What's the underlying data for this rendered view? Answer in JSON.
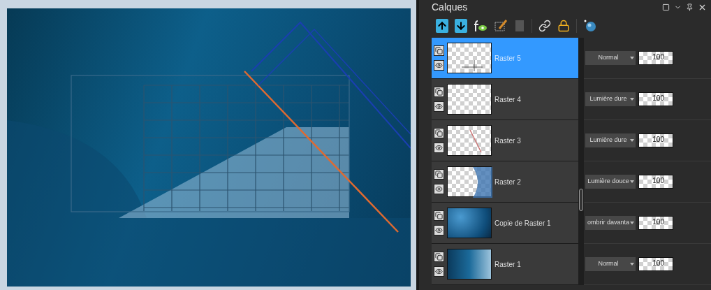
{
  "panel": {
    "title": "Calques"
  },
  "layers": [
    {
      "name": "Raster 5",
      "selected": true,
      "kind": "cross",
      "blend_mode": "Normal",
      "opacity": "100"
    },
    {
      "name": "Raster 4",
      "selected": false,
      "kind": "empty",
      "blend_mode": "Lumière dure",
      "opacity": "100"
    },
    {
      "name": "Raster 3",
      "selected": false,
      "kind": "line",
      "blend_mode": "Lumière dure",
      "opacity": "100"
    },
    {
      "name": "Raster 2",
      "selected": false,
      "kind": "wave",
      "blend_mode": "Lumière douce",
      "opacity": "100"
    },
    {
      "name": "Copie de Raster 1",
      "selected": false,
      "kind": "texture",
      "blend_mode": "ombrir davanta",
      "opacity": "100"
    },
    {
      "name": "Raster 1",
      "selected": false,
      "kind": "gradient",
      "blend_mode": "Normal",
      "opacity": "100"
    }
  ]
}
